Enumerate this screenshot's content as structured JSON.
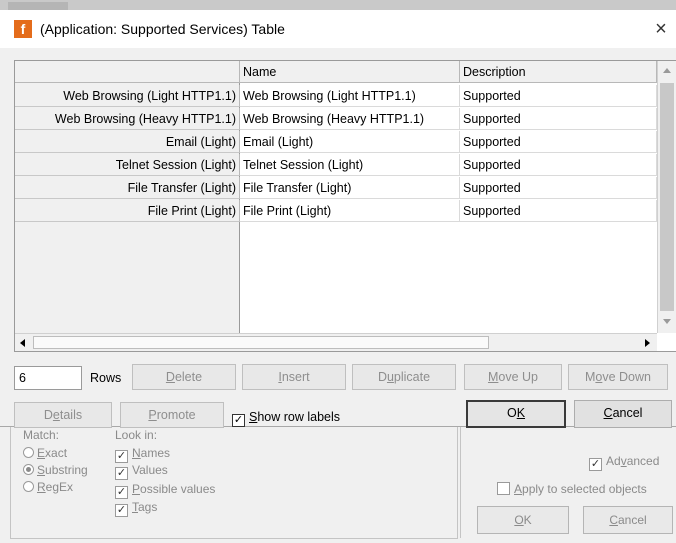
{
  "dialog": {
    "title": "(Application: Supported Services) Table",
    "icon_letter": "f",
    "close": "×"
  },
  "table": {
    "columns": [
      "Name",
      "Description"
    ],
    "rows": [
      {
        "label": "Web Browsing (Light HTTP1.1)",
        "name": "Web Browsing (Light HTTP1.1)",
        "description": "Supported"
      },
      {
        "label": "Web Browsing (Heavy HTTP1.1)",
        "name": "Web Browsing (Heavy HTTP1.1)",
        "description": "Supported"
      },
      {
        "label": "Email (Light)",
        "name": "Email (Light)",
        "description": "Supported"
      },
      {
        "label": "Telnet Session (Light)",
        "name": "Telnet Session (Light)",
        "description": "Supported"
      },
      {
        "label": "File Transfer (Light)",
        "name": "File Transfer (Light)",
        "description": "Supported"
      },
      {
        "label": "File Print (Light)",
        "name": "File Print (Light)",
        "description": "Supported"
      }
    ]
  },
  "controls": {
    "rows_value": "6",
    "rows_label": "Rows",
    "delete_accel": "D",
    "delete_rest": "elete",
    "insert_accel": "I",
    "insert_rest": "nsert",
    "duplicate_pre": "D",
    "duplicate_accel": "u",
    "duplicate_rest": "plicate",
    "moveup_accel": "M",
    "moveup_rest": "ove Up",
    "movedown_pre": "M",
    "movedown_accel": "o",
    "movedown_rest": "ve Down",
    "details_pre": "D",
    "details_accel": "e",
    "details_rest": "tails",
    "promote_accel": "P",
    "promote_rest": "romote",
    "show_labels_accel": "S",
    "show_labels_rest": "how row labels",
    "show_labels_checked": true,
    "ok_pre": "O",
    "ok_accel": "K",
    "cancel_accel": "C",
    "cancel_rest": "ancel"
  },
  "background_dialog": {
    "match_label": "Match:",
    "look_in_label": "Look in:",
    "match_options": [
      {
        "accel": "E",
        "rest": "xact",
        "selected": false
      },
      {
        "accel": "S",
        "rest": "ubstring",
        "selected": true
      },
      {
        "accel": "R",
        "rest": "egEx",
        "selected": false
      }
    ],
    "look_in_options": [
      {
        "accel": "N",
        "rest": "ames",
        "checked": true
      },
      {
        "accel": "",
        "rest": "Values",
        "checked": true
      },
      {
        "accel": "P",
        "rest": "ossible values",
        "checked": true
      },
      {
        "accel": "T",
        "rest": "ags",
        "checked": true
      }
    ],
    "advanced_pre": "Ad",
    "advanced_accel": "v",
    "advanced_rest": "anced",
    "apply_accel": "A",
    "apply_rest": "pply to selected objects",
    "ok_accel": "O",
    "ok_rest": "K",
    "cancel_accel": "C",
    "cancel_rest": "ancel"
  }
}
